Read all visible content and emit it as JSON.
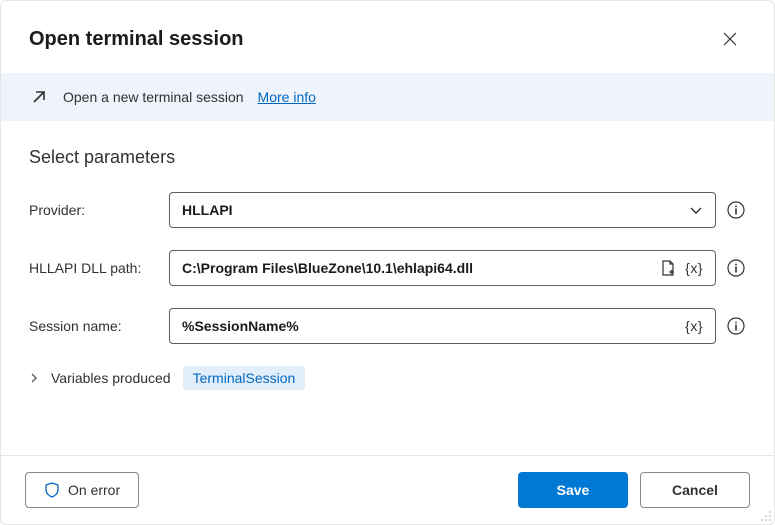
{
  "header": {
    "title": "Open terminal session"
  },
  "banner": {
    "text": "Open a new terminal session",
    "link": "More info"
  },
  "section": {
    "title": "Select parameters"
  },
  "fields": {
    "provider": {
      "label": "Provider:",
      "value": "HLLAPI"
    },
    "dllPath": {
      "label": "HLLAPI DLL path:",
      "value": "C:\\Program Files\\BlueZone\\10.1\\ehlapi64.dll"
    },
    "sessionName": {
      "label": "Session name:",
      "value": "%SessionName%"
    }
  },
  "variables": {
    "label": "Variables produced",
    "chip": "TerminalSession"
  },
  "footer": {
    "onError": "On error",
    "save": "Save",
    "cancel": "Cancel"
  },
  "varToken": "{x}"
}
